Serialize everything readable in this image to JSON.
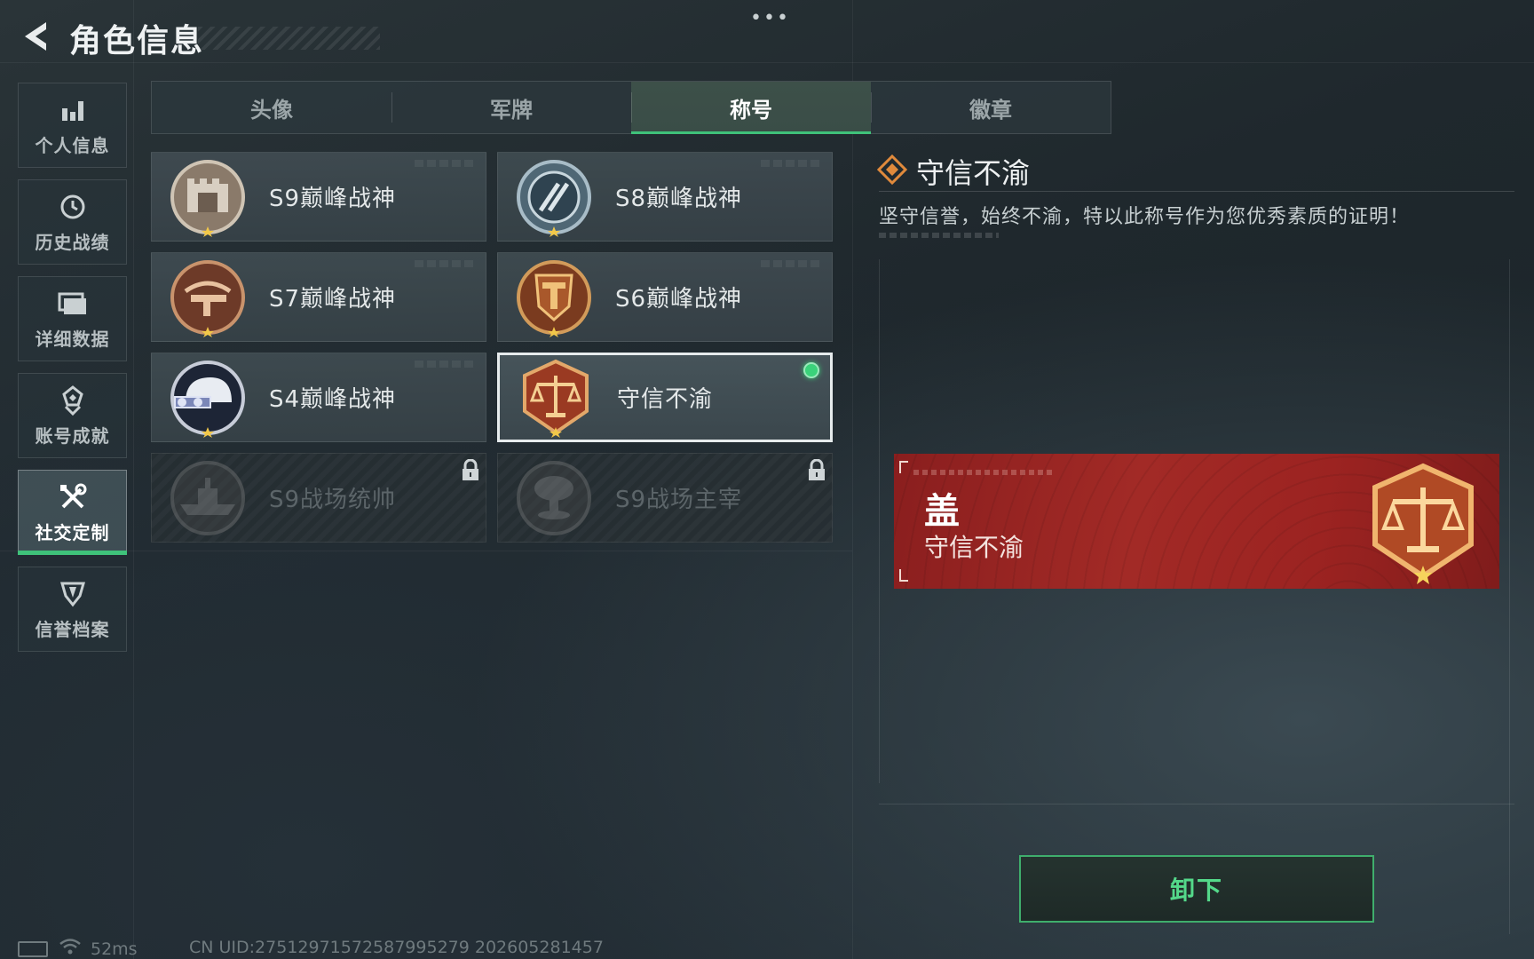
{
  "header": {
    "title": "角色信息"
  },
  "sidebar": {
    "items": [
      {
        "label": "个人信息",
        "icon": "bar-chart-icon",
        "active": false
      },
      {
        "label": "历史战绩",
        "icon": "history-clock-icon",
        "active": false
      },
      {
        "label": "详细数据",
        "icon": "folder-icon",
        "active": false
      },
      {
        "label": "账号成就",
        "icon": "achievement-badge-icon",
        "active": false
      },
      {
        "label": "社交定制",
        "icon": "tools-icon",
        "active": true
      },
      {
        "label": "信誉档案",
        "icon": "credit-shield-icon",
        "active": false
      }
    ]
  },
  "tabs": [
    {
      "label": "头像",
      "active": false
    },
    {
      "label": "军牌",
      "active": false
    },
    {
      "label": "称号",
      "active": true
    },
    {
      "label": "徽章",
      "active": false
    }
  ],
  "titles": [
    {
      "name": "S9巅峰战神",
      "emblem": "fortress-emblem-icon",
      "locked": false,
      "selected": false
    },
    {
      "name": "S8巅峰战神",
      "emblem": "striped-steel-emblem-icon",
      "locked": false,
      "selected": false
    },
    {
      "name": "S7巅峰战神",
      "emblem": "crossbow-emblem-icon",
      "locked": false,
      "selected": false
    },
    {
      "name": "S6巅峰战神",
      "emblem": "t-shield-emblem-icon",
      "locked": false,
      "selected": false
    },
    {
      "name": "S4巅峰战神",
      "emblem": "helmet-emblem-icon",
      "locked": false,
      "selected": false
    },
    {
      "name": "守信不渝",
      "emblem": "scales-emblem-icon",
      "locked": false,
      "selected": true,
      "equipped": true
    },
    {
      "name": "S9战场统帅",
      "emblem": "warship-emblem-icon",
      "locked": true,
      "selected": false
    },
    {
      "name": "S9战场主宰",
      "emblem": "mushroom-cloud-emblem-icon",
      "locked": true,
      "selected": false
    }
  ],
  "detail": {
    "name": "守信不渝",
    "description": "坚守信誉，始终不渝，特以此称号作为您优秀素质的证明！"
  },
  "preview": {
    "player_name": "盖",
    "title": "守信不渝"
  },
  "actions": {
    "unequip_label": "卸下"
  },
  "status_bar": {
    "ping": "52ms",
    "uid": "CN UID:2751297157258799527​9 202605281457"
  },
  "colors": {
    "accent_green": "#3fc27a",
    "banner_red": "#9c2321",
    "emblem_bronze": "#a5502f"
  }
}
